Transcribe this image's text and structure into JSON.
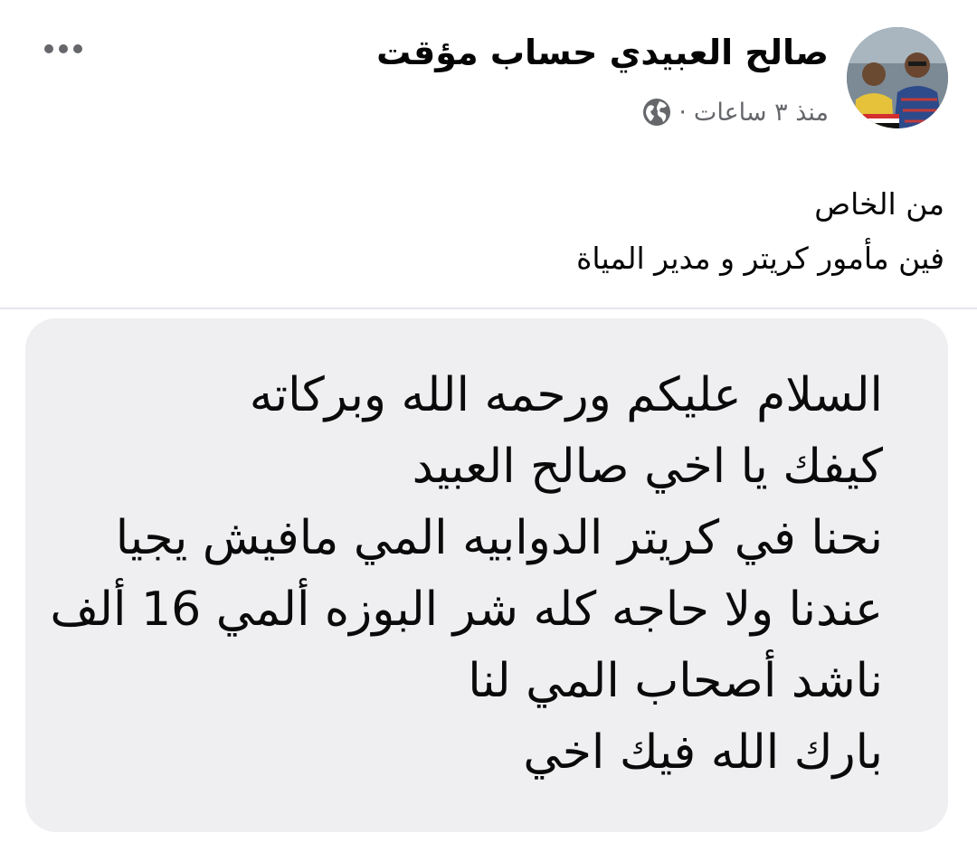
{
  "post": {
    "author": {
      "name": "صالح العبيدي حساب مؤقت",
      "avatar_icon": "profile-photo"
    },
    "meta": {
      "timestamp": "منذ ٣ ساعات",
      "separator": "·",
      "audience_icon": "globe-icon"
    },
    "more_icon": "more-horizontal-icon",
    "text_lines": [
      "من الخاص",
      "فين مأمور كريتر و مدير المياة"
    ],
    "shared_image": {
      "message_lines": [
        "السلام عليكم ورحمه الله وبركاته",
        "كيفك يا اخي صالح العبيد",
        "نحنا في كريتر الدوابيه المي مافيش يجيا",
        "عندنا ولا حاجه كله شر البوزه ألمي 16 ألف",
        "ناشد أصحاب المي لنا",
        "بارك الله فيك اخي"
      ]
    }
  },
  "colors": {
    "text_primary": "#050505",
    "text_secondary": "#65676b",
    "bubble_background": "#efeff1",
    "divider": "#e4e6eb"
  }
}
